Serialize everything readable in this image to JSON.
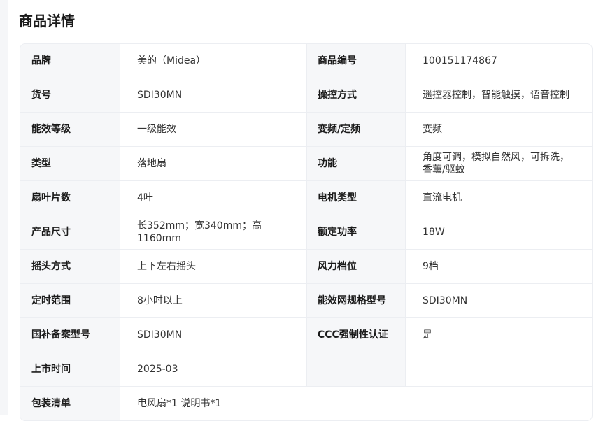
{
  "section_title": "商品详情",
  "rows": [
    {
      "k1": "品牌",
      "v1": "美的（Midea）",
      "k2": "商品编号",
      "v2": "100151174867"
    },
    {
      "k1": "货号",
      "v1": "SDI30MN",
      "k2": "操控方式",
      "v2": "遥控器控制，智能触摸，语音控制"
    },
    {
      "k1": "能效等级",
      "v1": "一级能效",
      "k2": "变频/定频",
      "v2": "变频"
    },
    {
      "k1": "类型",
      "v1": "落地扇",
      "k2": "功能",
      "v2": "角度可调，模拟自然风，可拆洗，香薰/驱蚊"
    },
    {
      "k1": "扇叶片数",
      "v1": "4叶",
      "k2": "电机类型",
      "v2": "直流电机"
    },
    {
      "k1": "产品尺寸",
      "v1": "长352mm；宽340mm；高1160mm",
      "k2": "额定功率",
      "v2": "18W"
    },
    {
      "k1": "摇头方式",
      "v1": "上下左右摇头",
      "k2": "风力档位",
      "v2": "9档"
    },
    {
      "k1": "定时范围",
      "v1": "8小时以上",
      "k2": "能效网规格型号",
      "v2": "SDI30MN"
    },
    {
      "k1": "国补备案型号",
      "v1": "SDI30MN",
      "k2": "CCC强制性认证",
      "v2": "是"
    },
    {
      "k1": "上市时间",
      "v1": "2025-03",
      "k2": "",
      "v2": ""
    }
  ],
  "package": {
    "label": "包装清单",
    "value": "电风扇*1 说明书*1"
  }
}
